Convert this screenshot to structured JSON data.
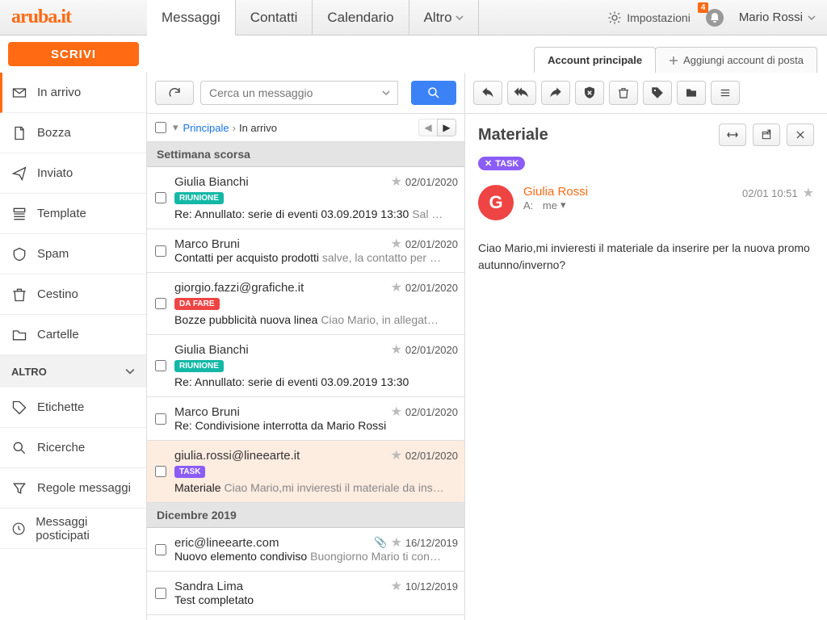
{
  "brand": "aruba.it",
  "topTabs": {
    "messages": "Messaggi",
    "contacts": "Contatti",
    "calendar": "Calendario",
    "other": "Altro"
  },
  "header": {
    "settings": "Impostazioni",
    "notificationCount": "4",
    "username": "Mario Rossi"
  },
  "compose": "SCRIVI",
  "accountTabs": {
    "main": "Account principale",
    "add": "Aggiungi account di posta"
  },
  "sidebar": {
    "inbox": "In arrivo",
    "drafts": "Bozza",
    "sent": "Inviato",
    "template": "Template",
    "spam": "Spam",
    "trash": "Cestino",
    "folders": "Cartelle",
    "section": "ALTRO",
    "labels": "Etichette",
    "searches": "Ricerche",
    "rules": "Regole messaggi",
    "postponed": "Messaggi posticipati"
  },
  "search": {
    "placeholder": "Cerca un messaggio"
  },
  "breadcrumb": {
    "root": "Principale",
    "current": "In arrivo"
  },
  "listSections": {
    "lastWeek": "Settimana scorsa",
    "dec2019": "Dicembre 2019"
  },
  "tagLabels": {
    "riunione": "RIUNIONE",
    "daFare": "DA FARE",
    "task": "TASK"
  },
  "tagColors": {
    "riunione": "#14b8a6",
    "daFare": "#ef4444",
    "task": "#8b5cf6"
  },
  "messages": [
    {
      "sender": "Giulia Bianchi",
      "date": "02/01/2020",
      "tag": "riunione",
      "subject": "Re: Annullato: serie di eventi 03.09.2019 13:30",
      "preview": "Sal …"
    },
    {
      "sender": "Marco Bruni",
      "date": "02/01/2020",
      "subject": "Contatti per acquisto prodotti",
      "preview": "salve, la contatto per …"
    },
    {
      "sender": "giorgio.fazzi@grafiche.it",
      "date": "02/01/2020",
      "tag": "daFare",
      "subject": "Bozze pubblicità nuova linea",
      "preview": "Ciao Mario, in allegat…"
    },
    {
      "sender": "Giulia Bianchi",
      "date": "02/01/2020",
      "tag": "riunione",
      "subject": "Re: Annullato: serie di eventi 03.09.2019 13:30",
      "preview": ""
    },
    {
      "sender": "Marco Bruni",
      "date": "02/01/2020",
      "subject": "Re: Condivisione interrotta da Mario Rossi",
      "preview": ""
    },
    {
      "sender": "giulia.rossi@lineearte.it",
      "date": "02/01/2020",
      "tag": "task",
      "subject": "Materiale",
      "preview": "Ciao Mario,mi invieresti il materiale da ins…",
      "selected": true
    },
    {
      "sender": "eric@lineearte.com",
      "date": "16/12/2019",
      "attachment": true,
      "subject": "Nuovo elemento condiviso",
      "preview": "Buongiorno Mario ti con…"
    },
    {
      "sender": "Sandra Lima",
      "date": "10/12/2019",
      "subject": "Test completato",
      "preview": ""
    }
  ],
  "reading": {
    "title": "Materiale",
    "tag": "TASK",
    "sender": "Giulia Rossi",
    "avatarInitial": "G",
    "recipientLabel": "A:",
    "recipient": "me",
    "sentAt": "02/01 10:51",
    "body": "Ciao Mario,mi invieresti il materiale da inserire per la nuova promo autunno/inverno?"
  }
}
